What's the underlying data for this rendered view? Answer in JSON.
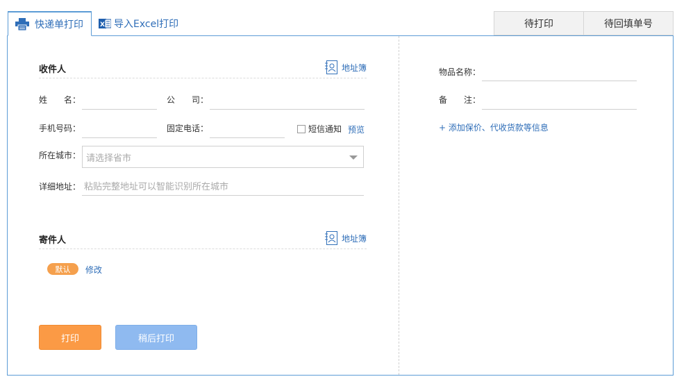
{
  "tabs": {
    "express_print": "快递单打印",
    "excel_import": "导入Excel打印",
    "pending_print": "待打印",
    "pending_fill": "待回填单号"
  },
  "recipient": {
    "title": "收件人",
    "address_book": "地址簿",
    "name_label": "姓　　名：",
    "company_label": "公　　司：",
    "mobile_label": "手机号码：",
    "phone_label": "固定电话：",
    "sms_label": "短信通知",
    "preview_label": "预览",
    "city_label": "所在城市：",
    "city_placeholder": "请选择省市",
    "address_label": "详细地址：",
    "address_placeholder": "粘贴完整地址可以智能识别所在城市"
  },
  "sender": {
    "title": "寄件人",
    "address_book": "地址簿",
    "default_badge": "默认",
    "edit_label": "修改"
  },
  "buttons": {
    "print": "打印",
    "print_later": "稍后打印"
  },
  "goods": {
    "name_label": "物品名称：",
    "remark_label": "备　　注：",
    "add_info": "+ 添加保价、代收货款等信息"
  },
  "colors": {
    "accent": "#2f6eb8",
    "border": "#5b9bd5",
    "print_button": "#fb9a45",
    "later_button": "#8fbaf0",
    "badge": "#f5a04d"
  }
}
